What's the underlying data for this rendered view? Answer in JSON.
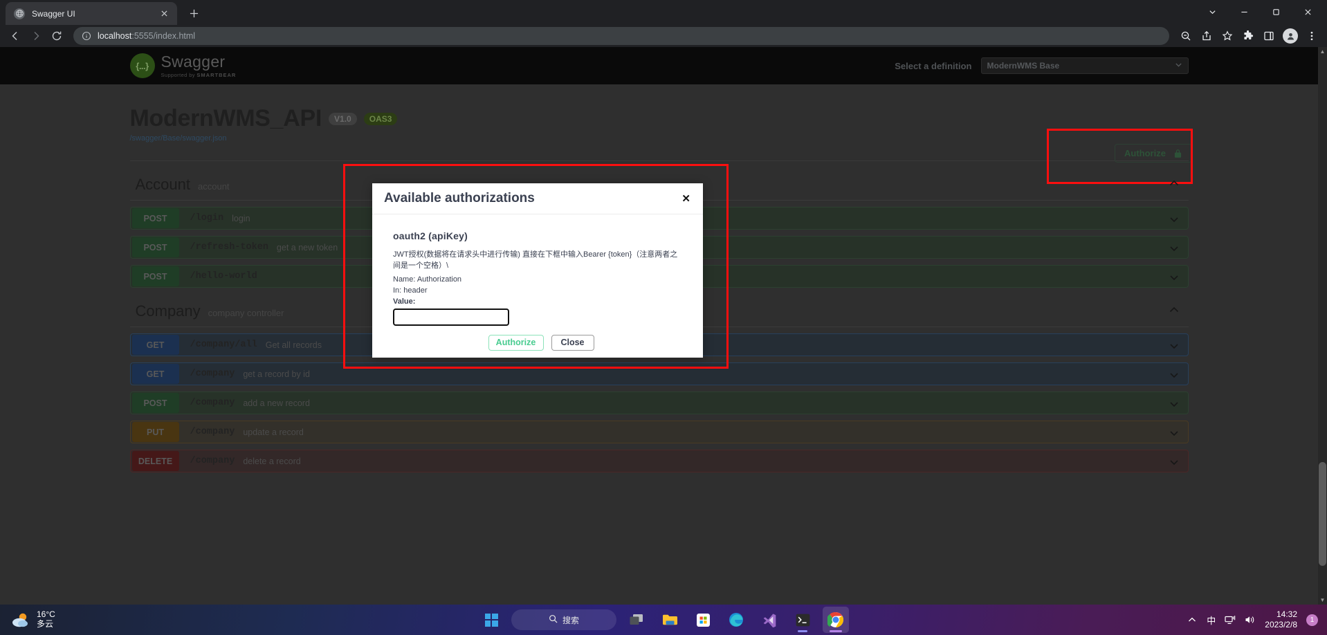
{
  "browser": {
    "tab": {
      "title": "Swagger UI",
      "favicon_icon": "globe-icon",
      "close_icon": "close-icon"
    },
    "new_tab_label": "+",
    "window_controls": {
      "minimize": "–",
      "maximize": "☐",
      "close": "✕",
      "chevron": "∨"
    },
    "nav": {
      "back_icon": "arrow-left-icon",
      "forward_icon": "arrow-right-icon",
      "reload_icon": "reload-icon"
    },
    "omnibox": {
      "info_icon": "info-circle-icon",
      "url_host": "localhost",
      "url_rest": ":5555/index.html"
    },
    "toolbar_icons": [
      "zoom-out-icon",
      "share-icon",
      "bookmark-star-icon",
      "extensions-puzzle-icon",
      "sidebar-panel-icon",
      "profile-avatar-icon",
      "more-vertical-icon"
    ]
  },
  "swagger": {
    "topbar": {
      "logo_text": "Swagger",
      "logo_mark": "{...}",
      "logo_sub_prefix": "Supported by",
      "logo_sub_brand": "SMARTBEAR",
      "definition_label": "Select a definition",
      "definition_value": "ModernWMS Base",
      "definition_chevron": "chevron-down-icon"
    },
    "info": {
      "title": "ModernWMS_API",
      "version_badge": "V1.0",
      "oas_badge": "OAS3",
      "spec_url": "/swagger/Base/swagger.json"
    },
    "authorize": {
      "label": "Authorize",
      "lock_icon": "lock-icon"
    },
    "tags": [
      {
        "name": "Account",
        "description": "account",
        "collapse_icon": "chevron-up-icon",
        "operations": [
          {
            "method": "POST",
            "type": "post",
            "path": "/login",
            "summary": "login",
            "chevron": "chevron-down-icon"
          },
          {
            "method": "POST",
            "type": "post",
            "path": "/refresh-token",
            "summary": "get a new token",
            "chevron": "chevron-down-icon"
          },
          {
            "method": "POST",
            "type": "post",
            "path": "/hello-world",
            "summary": "",
            "chevron": "chevron-down-icon"
          }
        ]
      },
      {
        "name": "Company",
        "description": "company controller",
        "collapse_icon": "chevron-up-icon",
        "operations": [
          {
            "method": "GET",
            "type": "get",
            "path": "/company/all",
            "summary": "Get all records",
            "chevron": "chevron-down-icon"
          },
          {
            "method": "GET",
            "type": "get",
            "path": "/company",
            "summary": "get a record by id",
            "chevron": "chevron-down-icon"
          },
          {
            "method": "POST",
            "type": "post",
            "path": "/company",
            "summary": "add a new record",
            "chevron": "chevron-down-icon"
          },
          {
            "method": "PUT",
            "type": "put",
            "path": "/company",
            "summary": "update a record",
            "chevron": "chevron-down-icon"
          },
          {
            "method": "DELETE",
            "type": "delete",
            "path": "/company",
            "summary": "delete a record",
            "chevron": "chevron-down-icon"
          }
        ]
      }
    ],
    "modal": {
      "title": "Available authorizations",
      "close_icon": "close-icon",
      "close_glyph": "✕",
      "scheme_title": "oauth2 (apiKey)",
      "scheme_description": "JWT授权(数据将在请求头中进行传输) 直接在下框中输入Bearer {token}（注意两者之间是一个空格）\\",
      "name_line": "Name: Authorization",
      "in_line": "In: header",
      "value_label": "Value:",
      "value_input": "",
      "value_placeholder": "",
      "authorize_label": "Authorize",
      "close_label": "Close"
    }
  },
  "colors": {
    "highlight_red": "#fb0f0f",
    "swagger_green": "#49cc90",
    "get_blue": "#1b3050",
    "post_green": "#1f3d26",
    "put_orange": "#493511",
    "delete_red": "#451818"
  },
  "taskbar": {
    "weather": {
      "temp": "16°C",
      "condition": "多云",
      "icon": "partly-cloudy-icon"
    },
    "start_icon": "windows-start-icon",
    "search_placeholder": "搜索",
    "search_icon": "search-icon",
    "apps": [
      {
        "name": "task-view-icon"
      },
      {
        "name": "file-explorer-icon"
      },
      {
        "name": "microsoft-store-icon"
      },
      {
        "name": "microsoft-edge-icon"
      },
      {
        "name": "visual-studio-icon"
      },
      {
        "name": "terminal-icon"
      },
      {
        "name": "google-chrome-icon"
      }
    ],
    "tray": {
      "overflow_icon": "chevron-up-icon",
      "ime_label": "中",
      "network_icon": "network-icon",
      "volume_icon": "volume-icon",
      "time": "14:32",
      "date": "2023/2/8",
      "notification_count": "1"
    }
  }
}
